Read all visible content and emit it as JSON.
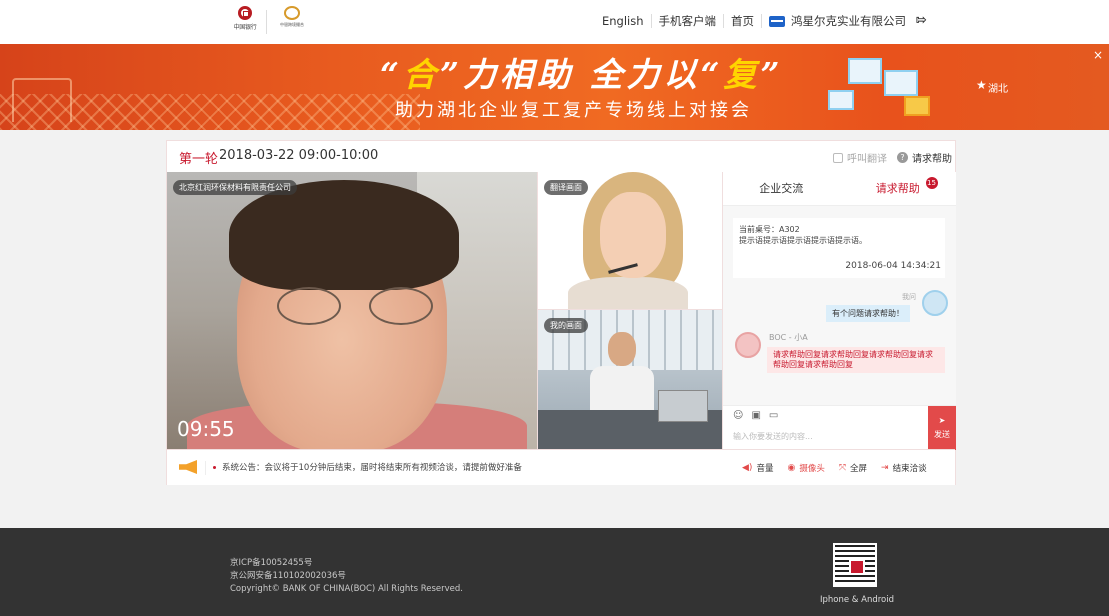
{
  "header": {
    "boc_logo_text": "中国银行",
    "partner_logo_text": "中银跨境撮合",
    "nav": {
      "english": "English",
      "mobile": "手机客户端",
      "home": "首页",
      "company": "鸿星尔克实业有限公司"
    }
  },
  "banner": {
    "title_part1": "合",
    "title_part2": "力相助 全力以",
    "title_part3": "复",
    "subtitle": "助力湖北企业复工复产专场线上对接会",
    "map_label": "湖北"
  },
  "session": {
    "round": "第一轮",
    "time": "2018-03-22 09:00-10:00",
    "call_translator": "呼叫翻译",
    "request_help": "请求帮助"
  },
  "videos": {
    "main_tag": "北京红润环保材料有限责任公司",
    "timer": "09:55",
    "translator_tag": "翻译画面",
    "my_tag": "我的画面"
  },
  "chat": {
    "tab_business": "企业交流",
    "tab_help": "请求帮助",
    "help_badge": "15",
    "notice_line1": "当前桌号：A302",
    "notice_line2": "提示语提示语提示语提示语提示语。",
    "notice_time": "2018-06-04 14:34:21",
    "me_label": "我问",
    "me_message": "有个问题请求帮助！",
    "boc_label": "BOC - 小A",
    "boc_message": "请求帮助回复请求帮助回复请求帮助回复请求帮助回复请求帮助回复",
    "input_placeholder": "输入你要发送的内容...",
    "send_label": "发送"
  },
  "bottom": {
    "announcement": "系统公告：会议将于10分钟后结束，届时将结束所有视频洽谈，请提前做好准备",
    "volume": "音量",
    "camera": "摄像头",
    "fullscreen": "全屏",
    "end": "结束洽谈"
  },
  "footer": {
    "icp": "京ICP备10052455号",
    "security": "京公网安备110102002036号",
    "copyright": "Copyright© BANK OF CHINA(BOC) All Rights Reserved.",
    "app_label": "Iphone & Android"
  }
}
